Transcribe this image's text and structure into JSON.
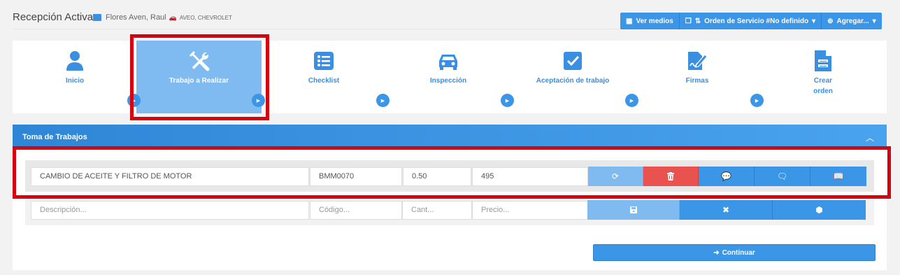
{
  "header": {
    "title": "Recepción Activa",
    "client_name": "Flores Aven, Raul",
    "vehicle": "AVEO, CHEVROLET"
  },
  "toolbar": {
    "ver_medios": "Ver medios",
    "orden_servicio": "Orden de Servicio #No definido",
    "agregar": "Agregar..."
  },
  "steps": [
    {
      "label": "Inicio",
      "icon": "user-icon"
    },
    {
      "label": "Trabajo a Realizar",
      "icon": "tools-icon",
      "active": true
    },
    {
      "label": "Checklist",
      "icon": "list-icon"
    },
    {
      "label": "Inspección",
      "icon": "car-icon"
    },
    {
      "label": "Aceptación de trabajo",
      "icon": "checkbox-icon"
    },
    {
      "label": "Firmas",
      "icon": "signature-icon"
    },
    {
      "label": "Crear orden",
      "icon": "document-icon"
    }
  ],
  "panel": {
    "title": "Toma de Trabajos"
  },
  "job_row": {
    "description": "CAMBIO DE ACEITE Y FILTRO DE MOTOR",
    "code": "BMM0070",
    "quantity": "0.50",
    "price": "495"
  },
  "new_row": {
    "description_placeholder": "Descripción...",
    "code_placeholder": "Código...",
    "quantity_placeholder": "Cant...",
    "price_placeholder": "Precio..."
  },
  "continue_label": "Continuar",
  "colors": {
    "primary": "#3b96e8",
    "active_step": "#7fbaf0",
    "danger": "#e9524f",
    "highlight": "#d6000f"
  }
}
